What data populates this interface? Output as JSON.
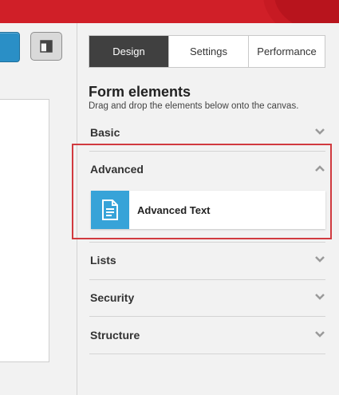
{
  "tabs": [
    {
      "label": "Design",
      "active": true
    },
    {
      "label": "Settings",
      "active": false
    },
    {
      "label": "Performance",
      "active": false
    }
  ],
  "panel": {
    "title": "Form elements",
    "subtitle": "Drag and drop the elements below onto the canvas."
  },
  "sections": {
    "basic": {
      "label": "Basic",
      "expanded": false
    },
    "advanced": {
      "label": "Advanced",
      "expanded": true,
      "items": [
        {
          "label": "Advanced Text",
          "icon": "document-icon"
        }
      ]
    },
    "lists": {
      "label": "Lists",
      "expanded": false
    },
    "security": {
      "label": "Security",
      "expanded": false
    },
    "structure": {
      "label": "Structure",
      "expanded": false
    }
  },
  "colors": {
    "header": "#d01f28",
    "active_tab": "#404040",
    "item_icon_bg": "#37a3d8",
    "highlight": "#d13a3f",
    "primary_button": "#2a8fc6"
  }
}
